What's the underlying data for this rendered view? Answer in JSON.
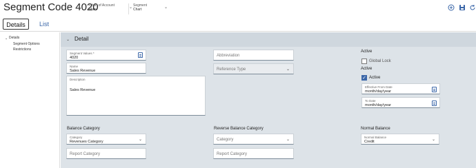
{
  "header": {
    "title": "Segment Code 4020",
    "chart_of_account": {
      "label": "Chart of Account",
      "value": "Main"
    },
    "segment": {
      "label": "Segment",
      "value": "Chart"
    }
  },
  "tabs": [
    {
      "label": "Details"
    },
    {
      "label": "List"
    }
  ],
  "sidebar": {
    "group_label": "Details",
    "items": [
      "Segment Options",
      "Restrictions"
    ]
  },
  "section": {
    "title": "Detail"
  },
  "form": {
    "segment_values": {
      "label": "Segment Values *",
      "value": "4020"
    },
    "name": {
      "label": "Name",
      "value": "Sales Revenue"
    },
    "description": {
      "label": "Description",
      "value": "Sales Revenue"
    },
    "abbreviation": {
      "placeholder": "Abbreviation"
    },
    "reference_type": {
      "placeholder": "Reference Type"
    },
    "active_heading": "Active",
    "global_lock": {
      "label": "Global Lock",
      "checked": false
    },
    "active_heading_2": "Active",
    "active": {
      "label": "Active",
      "checked": true
    },
    "effective_from": {
      "label": "Effective From Date",
      "value": "month/day/year"
    },
    "to_date": {
      "label": "To Date",
      "value": "month/day/year"
    },
    "balance_category": {
      "heading": "Balance Category",
      "category": {
        "label": "Category",
        "value": "Revenues Category"
      },
      "report_category": {
        "placeholder": "Report Category"
      }
    },
    "reverse_balance_category": {
      "heading": "Reverse Balance Category",
      "category": {
        "placeholder": "Category"
      },
      "report_category": {
        "placeholder": "Report Category"
      }
    },
    "normal_balance": {
      "heading": "Normal Balance",
      "field": {
        "label": "Normal Balance",
        "value": "Credit"
      }
    }
  },
  "icons": {
    "add": "plus-circle-icon",
    "save": "save-icon",
    "refresh": "refresh-icon",
    "accent": "#3a66a8"
  }
}
